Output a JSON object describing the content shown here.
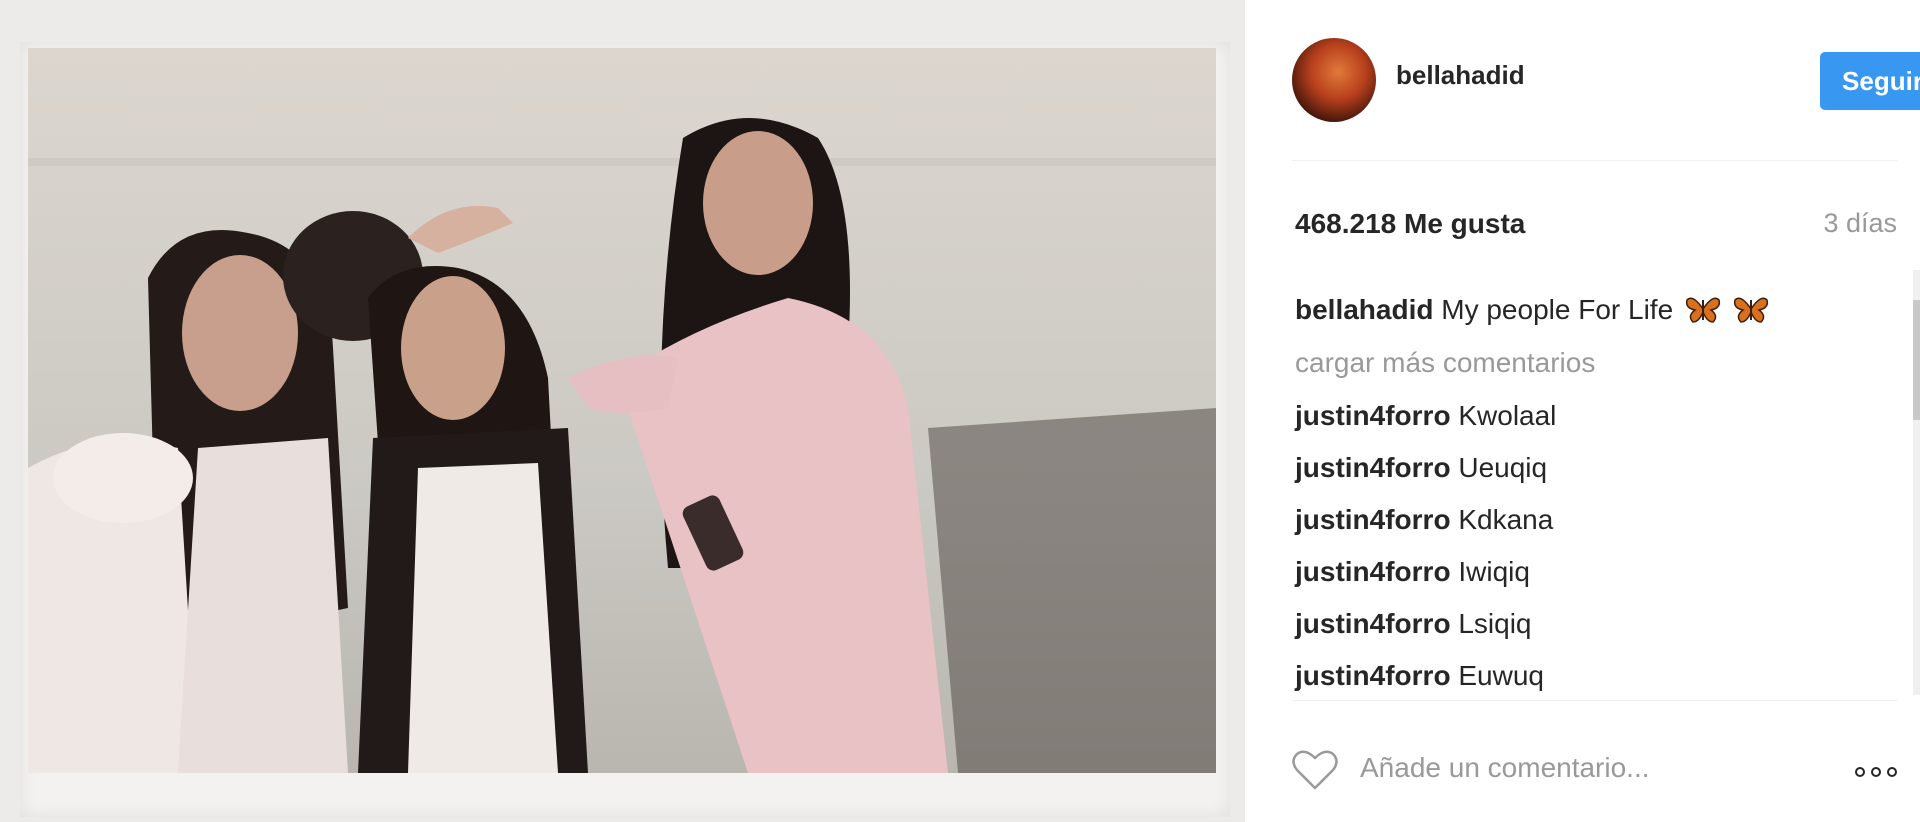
{
  "post": {
    "image_alt": "Polaroid photo of three women sitting together"
  },
  "header": {
    "username": "bellahadid",
    "follow_label": "Seguir",
    "avatar_icon": "profile-avatar"
  },
  "stats": {
    "likes": "468.218 Me gusta",
    "time": "3 días"
  },
  "caption": {
    "user": "bellahadid",
    "text": "My people For Life",
    "emoji_icons": [
      "butterfly-icon",
      "butterfly-icon"
    ]
  },
  "load_more": "cargar más comentarios",
  "comments": [
    {
      "user": "justin4forro",
      "text": "Kwolaal"
    },
    {
      "user": "justin4forro",
      "text": "Ueuqiq"
    },
    {
      "user": "justin4forro",
      "text": "Kdkana"
    },
    {
      "user": "justin4forro",
      "text": "Iwiqiq"
    },
    {
      "user": "justin4forro",
      "text": "Lsiqiq"
    },
    {
      "user": "justin4forro",
      "text": "Euwuq"
    }
  ],
  "comment_box": {
    "placeholder": "Añade un comentario...",
    "like_icon": "heart-icon",
    "more_icon": "more-options-icon"
  },
  "colors": {
    "accent": "#3897f0",
    "text": "#262626",
    "muted": "#999999",
    "divider": "#efefef"
  }
}
